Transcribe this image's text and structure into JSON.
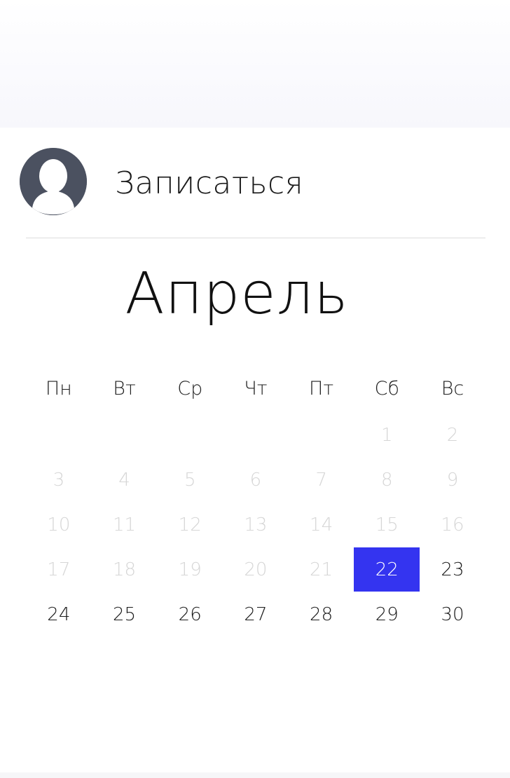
{
  "signup": {
    "label": "Записаться",
    "avatar_icon": "user-avatar-icon"
  },
  "calendar": {
    "month": "Апрель",
    "weekdays": [
      "Пн",
      "Вт",
      "Ср",
      "Чт",
      "Пт",
      "Сб",
      "Вс"
    ],
    "leading_blanks": 5,
    "days": [
      {
        "label": "1",
        "state": "disabled"
      },
      {
        "label": "2",
        "state": "disabled"
      },
      {
        "label": "3",
        "state": "disabled"
      },
      {
        "label": "4",
        "state": "disabled"
      },
      {
        "label": "5",
        "state": "disabled"
      },
      {
        "label": "6",
        "state": "disabled"
      },
      {
        "label": "7",
        "state": "disabled"
      },
      {
        "label": "8",
        "state": "disabled"
      },
      {
        "label": "9",
        "state": "disabled"
      },
      {
        "label": "10",
        "state": "disabled"
      },
      {
        "label": "11",
        "state": "disabled"
      },
      {
        "label": "12",
        "state": "disabled"
      },
      {
        "label": "13",
        "state": "disabled"
      },
      {
        "label": "14",
        "state": "disabled"
      },
      {
        "label": "15",
        "state": "disabled"
      },
      {
        "label": "16",
        "state": "disabled"
      },
      {
        "label": "17",
        "state": "disabled"
      },
      {
        "label": "18",
        "state": "disabled"
      },
      {
        "label": "19",
        "state": "disabled"
      },
      {
        "label": "20",
        "state": "disabled"
      },
      {
        "label": "21",
        "state": "disabled"
      },
      {
        "label": "22",
        "state": "selected"
      },
      {
        "label": "23",
        "state": "available"
      },
      {
        "label": "24",
        "state": "available"
      },
      {
        "label": "25",
        "state": "available"
      },
      {
        "label": "26",
        "state": "available"
      },
      {
        "label": "27",
        "state": "available"
      },
      {
        "label": "28",
        "state": "available"
      },
      {
        "label": "29",
        "state": "available"
      },
      {
        "label": "30",
        "state": "available"
      }
    ]
  },
  "colors": {
    "selected": "#3434f0",
    "avatar_bg": "#4b5160",
    "muted_text": "#d6d6d6"
  }
}
